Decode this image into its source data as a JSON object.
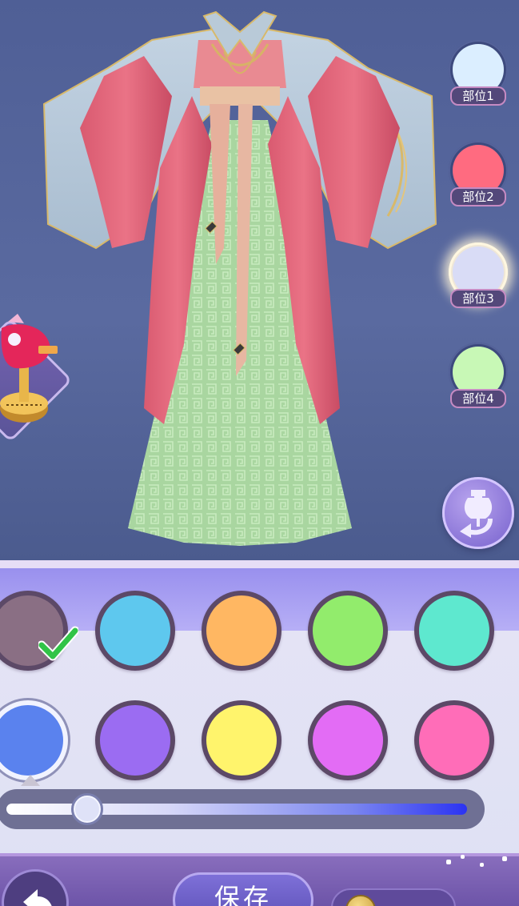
{
  "parts": [
    {
      "label": "部位1",
      "color": "#dbeeff",
      "active": false
    },
    {
      "label": "部位2",
      "color": "#ff6b80",
      "active": false
    },
    {
      "label": "部位3",
      "color": "#d9dcf6",
      "active": true
    },
    {
      "label": "部位4",
      "color": "#c8f8b6",
      "active": false
    }
  ],
  "palette_top_row": [
    "#8a6f84",
    "#5ec8ee",
    "#ffb762",
    "#92ec6c",
    "#5ee8cf"
  ],
  "palette_bottom_row": [
    "#5a82ee",
    "#9b6cf2",
    "#fff46c",
    "#e36cf5",
    "#ff6db8"
  ],
  "selected_color_index": 0,
  "slider_value": 0.14,
  "bottom_bar": {
    "save_label": "保存"
  },
  "icons": {
    "undo": "undo-arrow-icon",
    "swap": "mannequin-swap-icon",
    "back": "back-arrow-icon",
    "check": "check-icon",
    "coin": "coin-icon",
    "tool": "tailoring-tool-icon"
  }
}
